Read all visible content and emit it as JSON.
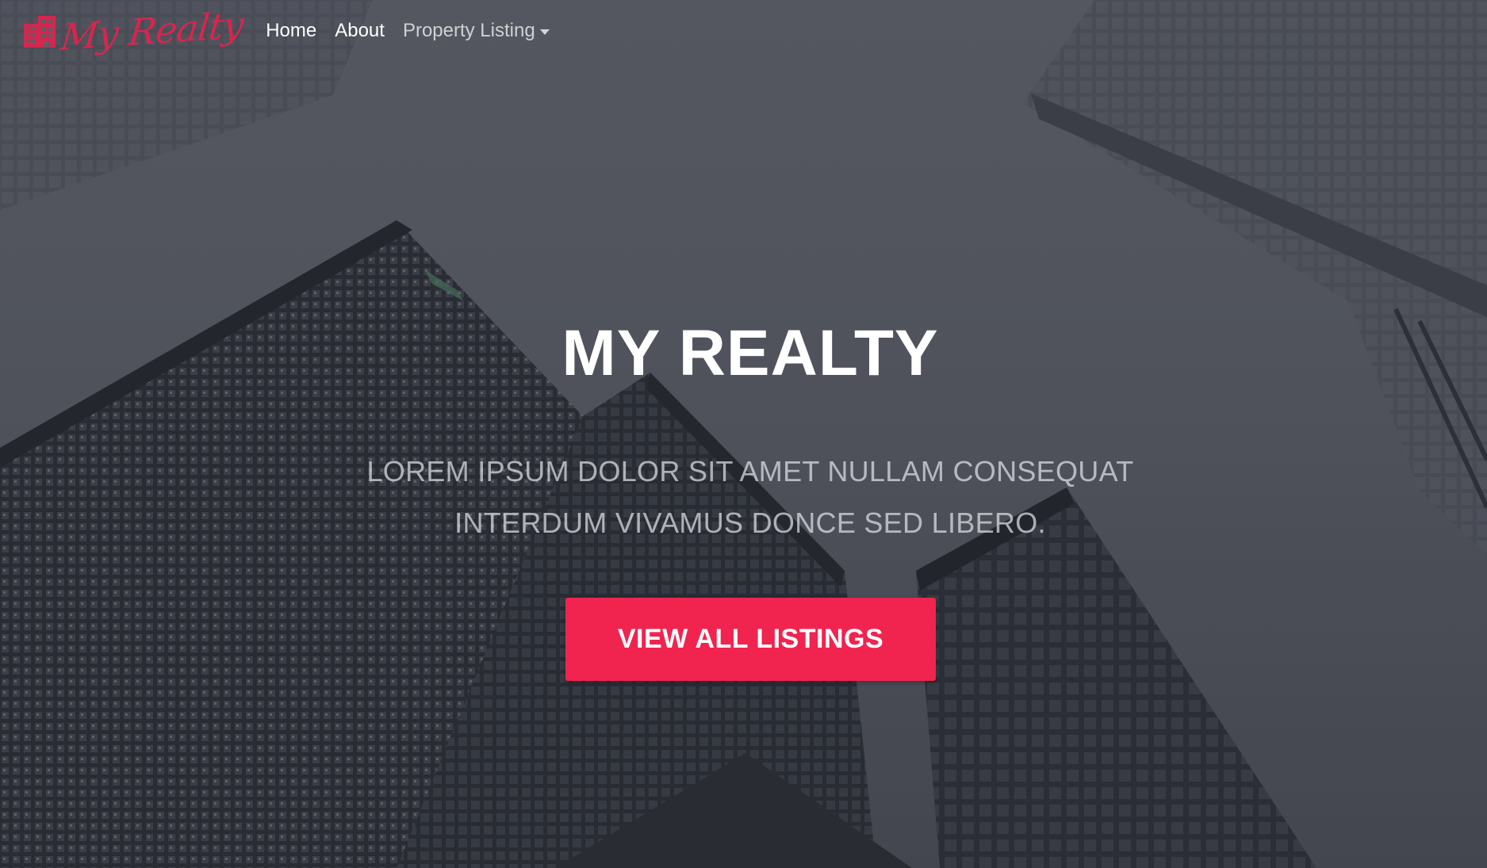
{
  "brand": {
    "logo_icon": "building-icon",
    "name": "My Realty",
    "accent_color": "#e0244e"
  },
  "nav": {
    "items": [
      {
        "label": "Home"
      },
      {
        "label": "About"
      },
      {
        "label": "Property Listing",
        "dropdown": true
      }
    ]
  },
  "hero": {
    "title": "MY REALTY",
    "subtitle_line1": "LOREM IPSUM DOLOR SIT AMET NULLAM CONSEQUAT",
    "subtitle_line2": "INTERDUM VIVAMUS DONCE SED LIBERO.",
    "cta_label": "VIEW ALL LISTINGS",
    "cta_color": "#f0244f"
  }
}
